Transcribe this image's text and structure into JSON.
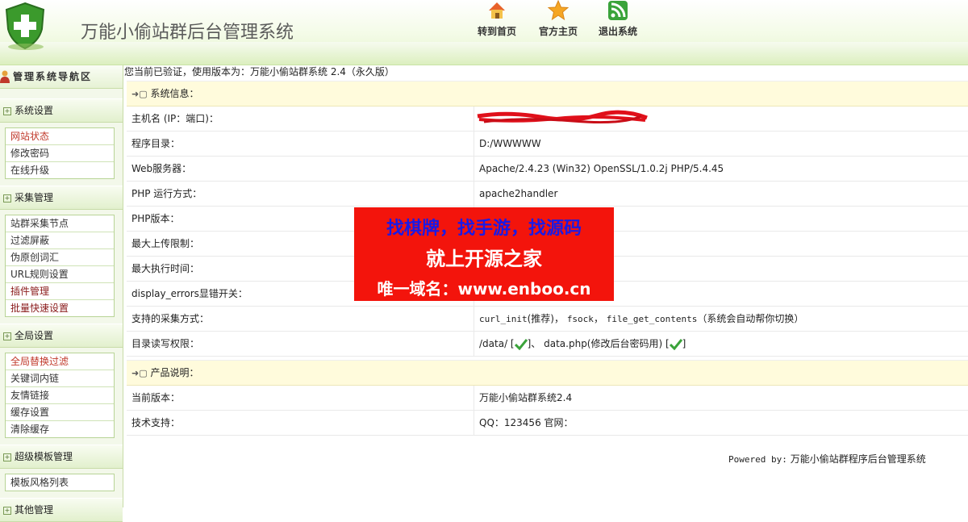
{
  "header": {
    "title": "万能小偷站群后台管理系统",
    "nav": [
      {
        "label": "转到首页",
        "icon": "home-icon"
      },
      {
        "label": "官方主页",
        "icon": "star-icon"
      },
      {
        "label": "退出系统",
        "icon": "rss-icon"
      }
    ]
  },
  "sidebar": {
    "title": "管理系统导航区",
    "groups": [
      {
        "title": "系统设置",
        "items": [
          "网站状态",
          "修改密码",
          "在线升级"
        ]
      },
      {
        "title": "采集管理",
        "items": [
          "站群采集节点",
          "过滤屏蔽",
          "伪原创词汇",
          "URL规则设置",
          "插件管理",
          "批量快速设置"
        ]
      },
      {
        "title": "全局设置",
        "items": [
          "全局替换过滤",
          "关键词内链",
          "友情链接",
          "缓存设置",
          "清除缓存"
        ]
      },
      {
        "title": "超级模板管理",
        "items": [
          "模板风格列表"
        ]
      },
      {
        "title": "其他管理",
        "items": []
      }
    ]
  },
  "main": {
    "verify_text": "您当前已验证，使用版本为：万能小偷站群系统 2.4（永久版）",
    "system_section": "系统信息：",
    "rows": [
      {
        "k": "主机名 (IP：端口)：",
        "v": ""
      },
      {
        "k": "程序目录：",
        "v": "D:/WWWWW"
      },
      {
        "k": "Web服务器：",
        "v": "Apache/2.4.23 (Win32) OpenSSL/1.0.2j PHP/5.4.45"
      },
      {
        "k": "PHP 运行方式：",
        "v": "apache2handler"
      },
      {
        "k": "PHP版本：",
        "v": ""
      },
      {
        "k": "最大上传限制：",
        "v": ""
      },
      {
        "k": "最大执行时间：",
        "v": ""
      },
      {
        "k": "display_errors显错开关：",
        "v": ""
      }
    ],
    "collect_label": "支持的采集方式：",
    "collect": {
      "m1": "curl_init",
      "t1": "(推荐)，",
      "m2": "fsock",
      "t2": "，",
      "m3": "file_get_contents",
      "t3": "（系统会自动帮你切换）"
    },
    "dir_label": "目录读写权限：",
    "dir": {
      "p1": "/data/ [",
      "p2": "]、 data.php(修改后台密码用) [",
      "p3": "]"
    },
    "product_section": "产品说明：",
    "product_rows": [
      {
        "k": "当前版本：",
        "v": "万能小偷站群系统2.4"
      },
      {
        "k": "技术支持：",
        "v": "QQ：123456   官网："
      }
    ],
    "powered_label": "Powered by:",
    "powered_text": "万能小偷站群程序后台管理系统"
  },
  "watermark": {
    "line1": "找棋牌，找手游，找源码",
    "line2": "就上开源之家",
    "line3": "唯一域名：www.enboo.cn"
  },
  "colors": {
    "accent_green": "#6aa63a",
    "header_bg": "#e2f2c9",
    "section_bg": "#fffbdc",
    "watermark_bg": "#f3140c"
  }
}
